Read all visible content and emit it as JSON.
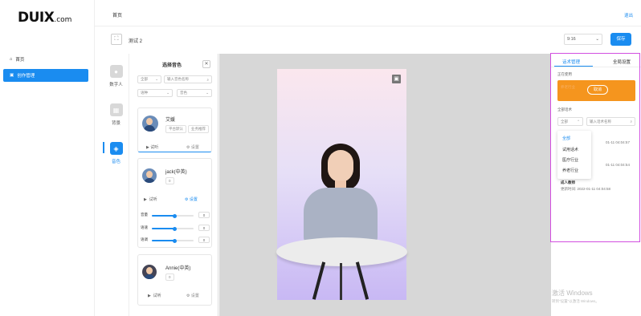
{
  "brand": {
    "logo": "DUIX",
    "logo_suffix": ".com"
  },
  "sidebar": {
    "items": [
      {
        "label": "首页",
        "icon": "home-icon"
      },
      {
        "label": "创作管理",
        "icon": "folder-icon"
      }
    ]
  },
  "topbar": {
    "title": "首页",
    "logout": "退出"
  },
  "toolbar": {
    "project_name": "测试 2",
    "ratio": "9:16",
    "save": "保存"
  },
  "tools": [
    {
      "label": "数字人",
      "icon": "person-icon"
    },
    {
      "label": "背景",
      "icon": "image-icon"
    },
    {
      "label": "音色",
      "icon": "audio-icon"
    }
  ],
  "picker": {
    "title": "选择音色",
    "filter_all": "全部",
    "search_placeholder": "输入音色名称",
    "filter_lang": "语种",
    "filter_gender": "音色",
    "voices": [
      {
        "name": "艾媛",
        "tags": [
          "平台默认",
          "业务推荐"
        ],
        "try": "试听",
        "settings": "设置"
      },
      {
        "name": "jack(中英)",
        "tags": [
          "0"
        ],
        "try": "试听",
        "settings": "设置"
      },
      {
        "name": "Annie(中英)",
        "tags": [
          "0"
        ],
        "try": "试听",
        "settings": "设置"
      }
    ],
    "sliders": [
      {
        "label": "音量",
        "value": "0",
        "level": 0.55
      },
      {
        "label": "语速",
        "value": "0",
        "level": 0.55
      },
      {
        "label": "语调",
        "value": "0",
        "level": 0.55
      }
    ]
  },
  "right": {
    "tabs": [
      "话术管理",
      "全局设置"
    ],
    "in_use_label": "正在使用",
    "in_use_card_text": "养老行业",
    "in_use_button": "取消",
    "all_scripts_label": "全部话术",
    "filter_value": "全部",
    "search_placeholder": "输入话术名称",
    "dropdown": [
      "全部",
      "试用话术",
      "医疗行业",
      "养老行业"
    ],
    "list": [
      {
        "title": "",
        "time": "01-11 04:04:57"
      },
      {
        "title": "",
        "time": "01-11 04:04:54"
      },
      {
        "title": "成人教师",
        "time": "更新时间: 2022-01-11 04:04:58"
      }
    ]
  },
  "watermark": {
    "line1": "激活 Windows",
    "line2": "转到\"设置\"以激活 Windows。"
  },
  "colors": {
    "accent": "#1a8cf0",
    "highlight": "#d24fe0",
    "orange": "#f5951e"
  }
}
